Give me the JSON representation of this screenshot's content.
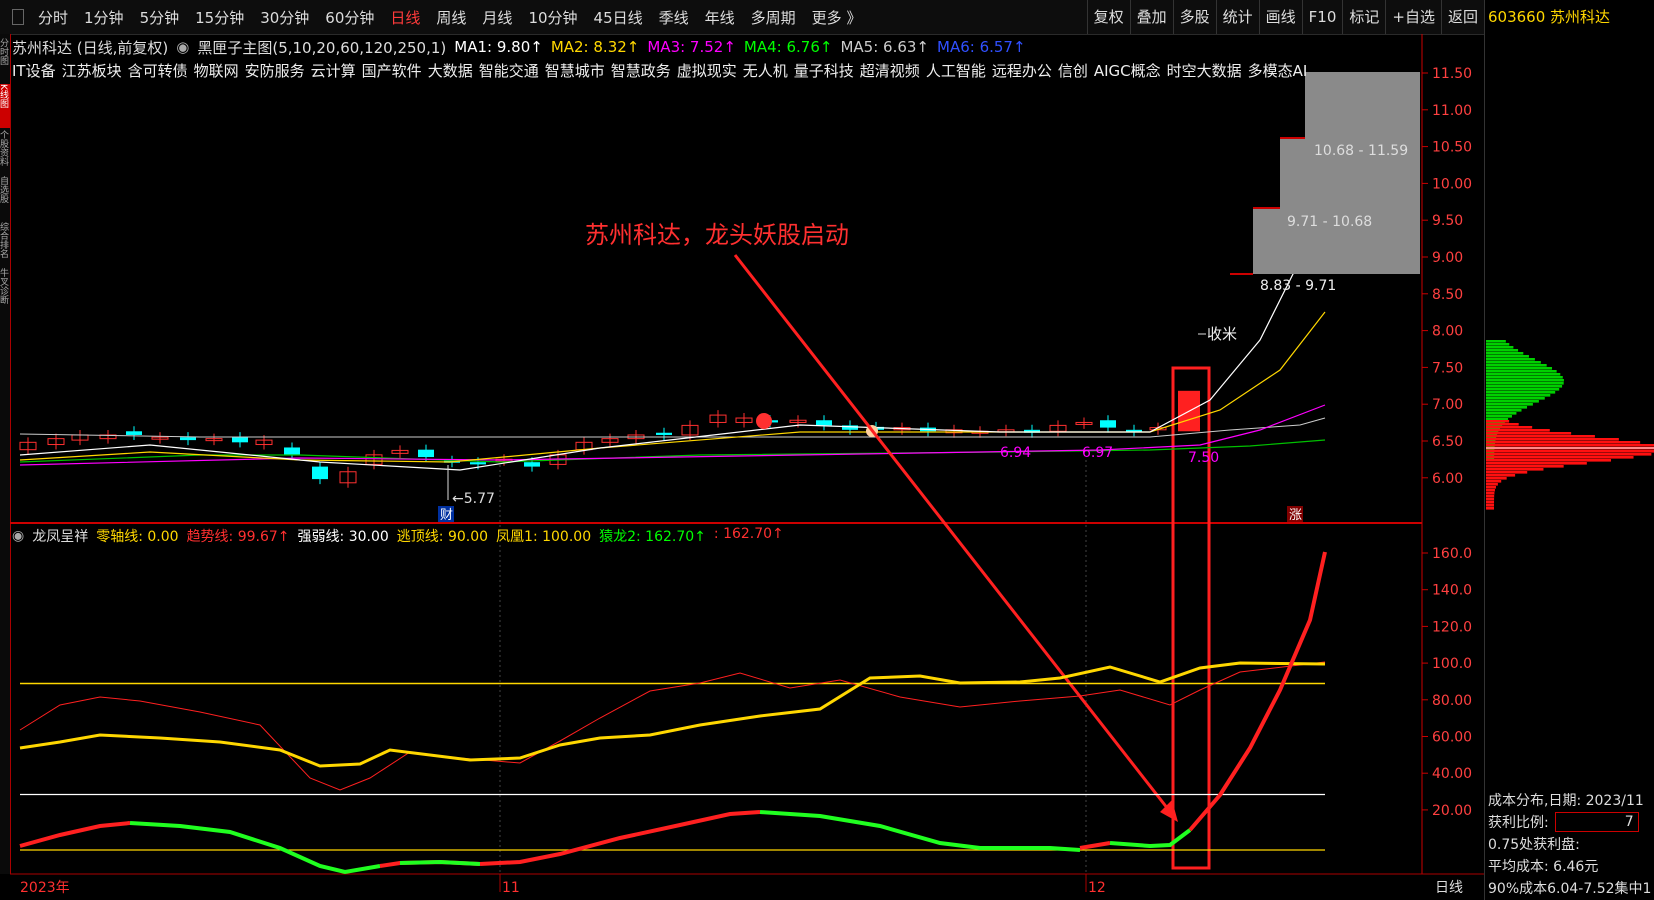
{
  "toolbar": {
    "periods": [
      "分时",
      "1分钟",
      "5分钟",
      "15分钟",
      "30分钟",
      "60分钟",
      "日线",
      "周线",
      "月线",
      "10分钟",
      "45日线",
      "季线",
      "年线",
      "多周期",
      "更多 》"
    ],
    "active_period": "日线",
    "right_buttons": [
      "复权",
      "叠加",
      "多股",
      "统计",
      "画线",
      "F10",
      "标记",
      "+自选",
      "返回"
    ]
  },
  "stock": {
    "code_name": "603660 苏州科达"
  },
  "main_header": {
    "title": "苏州科达 (日线,前复权)",
    "indicator": "黑匣子主图(5,10,20,60,120,250,1)",
    "ma": [
      {
        "label": "MA1: 9.80↑",
        "color": "#ffffff"
      },
      {
        "label": "MA2: 8.32↑",
        "color": "#ffd700"
      },
      {
        "label": "MA3: 7.52↑",
        "color": "#ff00ff"
      },
      {
        "label": "MA4: 6.76↑",
        "color": "#00ff00"
      },
      {
        "label": "MA5: 6.63↑",
        "color": "#cccccc"
      },
      {
        "label": "MA6: 6.57↑",
        "color": "#3050ff"
      }
    ]
  },
  "concepts": [
    "IT设备",
    "江苏板块",
    "含可转债",
    "物联网",
    "安防服务",
    "云计算",
    "国产软件",
    "大数据",
    "智能交通",
    "智慧城市",
    "智慧政务",
    "虚拟现实",
    "无人机",
    "量子科技",
    "超清视频",
    "人工智能",
    "远程办公",
    "信创",
    "AIGC概念",
    "时空大数据",
    "多模态AI"
  ],
  "left_tabs": [
    "分时图",
    "K线图",
    "个股资料",
    "自选股",
    "综合排名",
    "牛叉诊断"
  ],
  "price_axis": [
    "11.50",
    "11.00",
    "10.50",
    "10.00",
    "9.50",
    "9.00",
    "8.50",
    "8.00",
    "7.50",
    "7.00",
    "6.50",
    "6.00"
  ],
  "annotations": {
    "headline": "苏州科达，龙头妖股启动",
    "shoumi": "收米",
    "low_label": "5.77",
    "cai": "财",
    "zhang": "涨",
    "price_marks": [
      "6.94",
      "6.97",
      "7.50"
    ],
    "ranges": [
      "10.68 - 11.59",
      "9.71 - 10.68",
      "8.83 - 9.71"
    ]
  },
  "indicator_header": {
    "name": "龙凤呈祥",
    "items": [
      {
        "label": "零轴线: 0.00",
        "color": "#ffd700"
      },
      {
        "label": "趋势线: 99.67↑",
        "color": "#ff3030"
      },
      {
        "label": "强弱线: 30.00",
        "color": "#ffffff"
      },
      {
        "label": "逃顶线: 90.00",
        "color": "#ffd700"
      },
      {
        "label": "凤凰1: 100.00",
        "color": "#ffd700"
      },
      {
        "label": "猿龙2: 162.70↑",
        "color": "#00ff00"
      },
      {
        "label": ": 162.70↑",
        "color": "#ff3030"
      }
    ]
  },
  "indicator_axis": [
    "160.0",
    "140.0",
    "120.0",
    "100.0",
    "80.00",
    "60.00",
    "40.00",
    "20.00"
  ],
  "time_axis": {
    "year": "2023年",
    "m11": "11",
    "m12": "12",
    "period": "日线"
  },
  "cost_panel": {
    "date_line": "成本分布,日期: 2023/11",
    "profit_label": "获利比例:",
    "profit_value": "7",
    "profit_pos": "0.75处获利盘:",
    "avg_cost": "平均成本: 6.46元",
    "concentration": "90%成本6.04-7.52集中1"
  },
  "colors": {
    "up": "#ff2020",
    "down": "#00ffff",
    "accent": "#ffd700",
    "frame": "#c00000"
  }
}
